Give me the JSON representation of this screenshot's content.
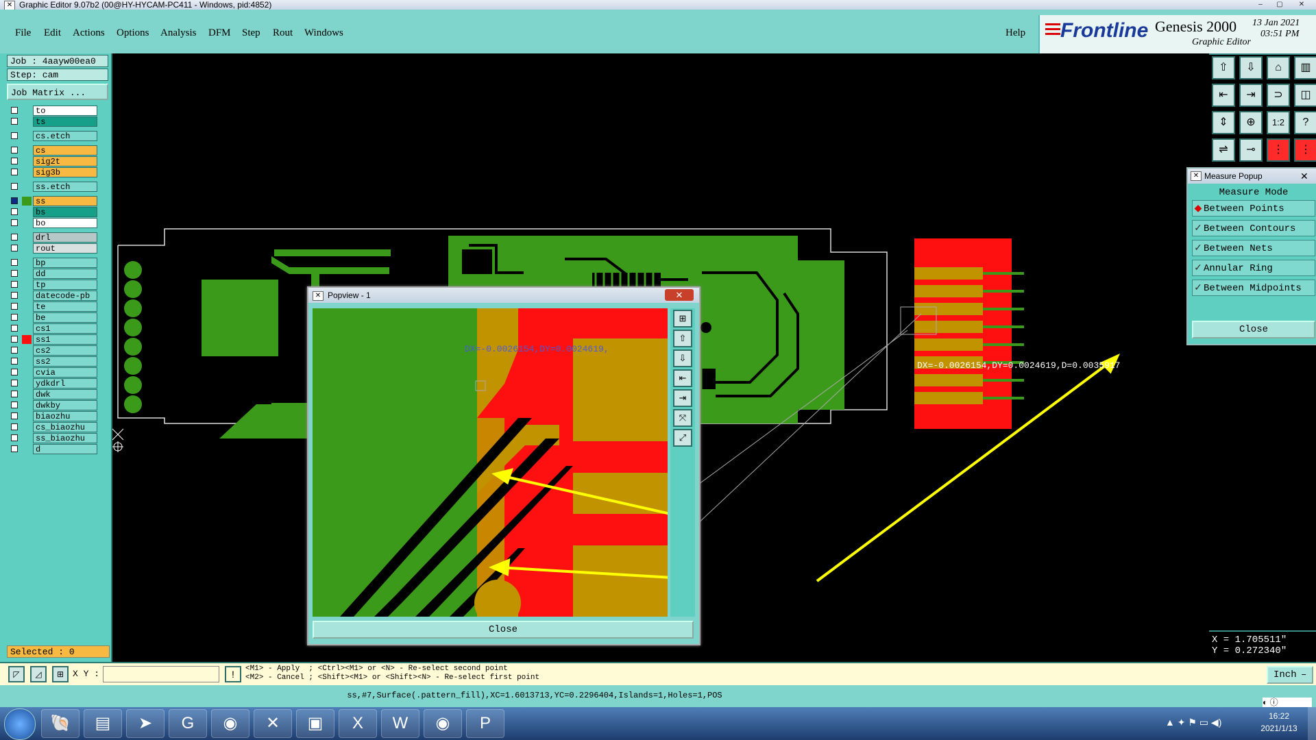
{
  "window": {
    "title": "Graphic Editor 9.07b2 (00@HY-HYCAM-PC411 - Windows, pid:4852)",
    "controls": [
      "–",
      "▢",
      "✕"
    ]
  },
  "menu": {
    "items": [
      "File",
      "Edit",
      "Actions",
      "Options",
      "Analysis",
      "DFM",
      "Step",
      "Rout",
      "Windows"
    ],
    "help": "Help"
  },
  "branding": {
    "logo": "Frontline",
    "product": "Genesis 2000",
    "subtitle": "Graphic Editor",
    "date": "13 Jan 2021",
    "time": "03:51 PM"
  },
  "job": {
    "job_label": "Job : 4aayw00ea0",
    "step_label": "Step: cam",
    "matrix_button": "Job Matrix ..."
  },
  "layers": [
    {
      "name": "to",
      "color": "#ffffff"
    },
    {
      "name": "ts",
      "color": "#17a089"
    },
    {
      "name": "cs.etch",
      "color": "#7fd9ce"
    },
    {
      "name": "cs",
      "color": "#f7b942"
    },
    {
      "name": "sig2t",
      "color": "#f7b942"
    },
    {
      "name": "sig3b",
      "color": "#f7b942"
    },
    {
      "name": "ss.etch",
      "color": "#7fd9ce"
    },
    {
      "name": "ss",
      "color": "#f7b942"
    },
    {
      "name": "bs",
      "color": "#17a089"
    },
    {
      "name": "bo",
      "color": "#ffffff"
    },
    {
      "name": "drl",
      "color": "#b5c7c6"
    },
    {
      "name": "rout",
      "color": "#d9e0e0"
    },
    {
      "name": "bp",
      "color": "#7fd9ce"
    },
    {
      "name": "dd",
      "color": "#7fd9ce"
    },
    {
      "name": "tp",
      "color": "#7fd9ce"
    },
    {
      "name": "datecode-pb",
      "color": "#7fd9ce"
    },
    {
      "name": "te",
      "color": "#7fd9ce"
    },
    {
      "name": "be",
      "color": "#7fd9ce"
    },
    {
      "name": "cs1",
      "color": "#7fd9ce"
    },
    {
      "name": "ss1",
      "color": "#7fd9ce"
    },
    {
      "name": "cs2",
      "color": "#7fd9ce"
    },
    {
      "name": "ss2",
      "color": "#7fd9ce"
    },
    {
      "name": "cvia",
      "color": "#7fd9ce"
    },
    {
      "name": "ydkdrl",
      "color": "#7fd9ce"
    },
    {
      "name": "dwk",
      "color": "#7fd9ce"
    },
    {
      "name": "dwkby",
      "color": "#7fd9ce"
    },
    {
      "name": "biaozhu",
      "color": "#7fd9ce"
    },
    {
      "name": "cs_biaozhu",
      "color": "#7fd9ce"
    },
    {
      "name": "ss_biaozhu",
      "color": "#7fd9ce"
    },
    {
      "name": "d",
      "color": "#7fd9ce"
    }
  ],
  "selected_label": "Selected : 0",
  "canvas": {
    "measure_text": "DX=-0.0026154,DY=0.0024619,D=0.0035917",
    "measure_text_partial": "DX=-0.0026154,DY=0.0024619,"
  },
  "toolbar": {
    "icons": [
      "zoom-home",
      "zoom-out",
      "home",
      "panel",
      "left-arrow",
      "right-arrow",
      "snap",
      "measure",
      "fit",
      "center",
      "ratio",
      "help",
      "flip",
      "pin",
      "nets",
      "nets2"
    ],
    "ratio_label": "1:2",
    "help_label": "?"
  },
  "measure_popup": {
    "title": "Measure Popup",
    "header": "Measure Mode",
    "modes": [
      "Between Points",
      "Between Contours",
      "Between Nets",
      "Annular Ring",
      "Between Midpoints"
    ],
    "selected_mode": "Between Points",
    "close_label": "Close"
  },
  "popview": {
    "title": "Popview - 1",
    "close_label": "Close"
  },
  "coords": {
    "x": "X = 1.705511\"",
    "y": "Y = 0.272340\""
  },
  "command": {
    "xy_label": "X Y :",
    "xy_value": "",
    "excl": "!",
    "hint1": "<M1> - Apply  ; <Ctrl><M1> or <N> - Re-select second point",
    "hint2": "<M2> - Cancel ; <Shift><M1> or <Shift><N> - Re-select first point",
    "units": "Inch"
  },
  "status": {
    "text": "ss,#7,Surface(.pattern_fill),XC=1.6013713,YC=0.2296404,Islands=1,Holes=1,POS"
  },
  "taskbar": {
    "time": "16:22",
    "date": "2021/1/13",
    "apps": [
      "explorer",
      "files",
      "messenger",
      "graphic",
      "eye",
      "x-app",
      "save",
      "excel",
      "word",
      "eye2",
      "p-app"
    ]
  }
}
